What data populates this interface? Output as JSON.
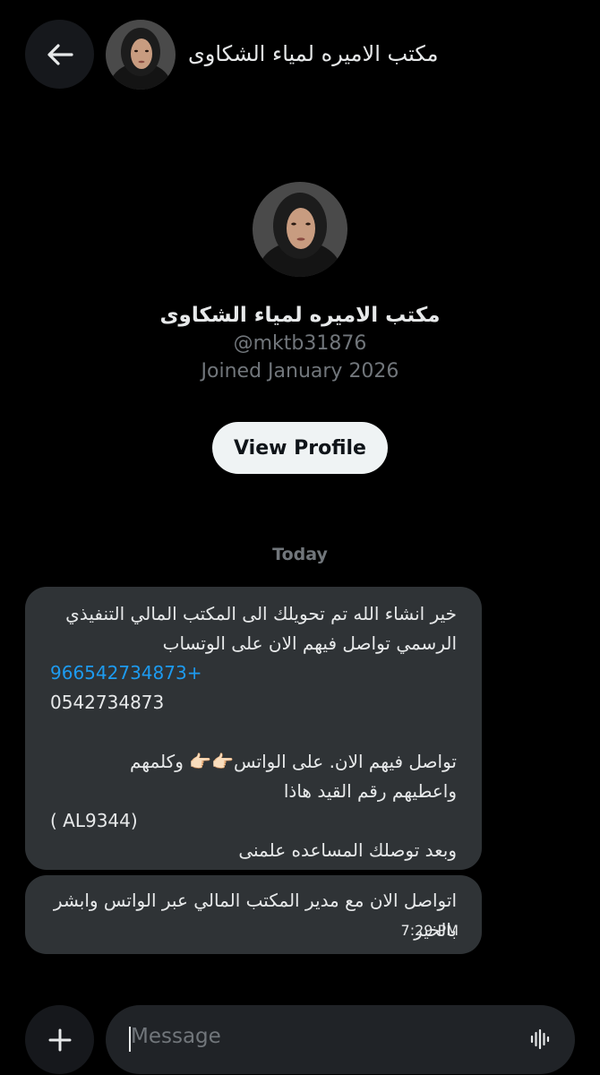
{
  "header": {
    "title": "مكتب الاميره لمياء الشكاوى",
    "back_icon": "arrow-left-icon"
  },
  "profile": {
    "name": "مكتب الاميره لمياء الشكاوى",
    "handle": "@mktb31876",
    "joined": "Joined January 2026",
    "view_profile_label": "View Profile"
  },
  "conversation": {
    "date_divider": "Today",
    "messages": [
      {
        "line1": "خير انشاء الله تم  تحويلك الى المكتب المالي التنفيذي",
        "line2": "الرسمي تواصل فيهم الان على الوتساب",
        "phone_link": "966542734873+",
        "phone_plain": "0542734873",
        "line5": "تواصل فيهم الان. على الواتس👉🏻👉🏻 وكلمهم",
        "line6": "واعطيهم رقم القيد هاذا",
        "code": "( AL9344)",
        "line8": "وبعد توصلك المساعده علمنى"
      },
      {
        "line1": "اتواصل الان مع مدير المكتب المالي عبر الواتس وابشر",
        "line2": "بالخير",
        "time": "7:29 PM"
      }
    ]
  },
  "composer": {
    "placeholder": "Message",
    "plus_icon": "plus-icon",
    "voice_icon": "voice-wave-icon"
  },
  "colors": {
    "background": "#000000",
    "bubble": "#2f3336",
    "link": "#1d9bf0",
    "muted": "#71767b",
    "button": "#eff3f4"
  }
}
